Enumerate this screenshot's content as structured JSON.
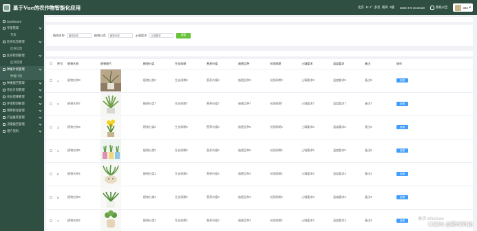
{
  "header": {
    "title": "基于Vue的农作物智能化应用",
    "location": "北京",
    "temperature": "11.1°",
    "weather": "多云",
    "wind": "南风",
    "wind_level": "2级",
    "datetime": "2024-4-9 10:20:23",
    "notice_label": "系统公告",
    "user_label": "333"
  },
  "sidebar": {
    "items": [
      {
        "label": "Dashboard",
        "type": "item"
      },
      {
        "label": "专家管理",
        "type": "group"
      },
      {
        "label": "专家",
        "type": "sub"
      },
      {
        "label": "区块信息管理",
        "type": "group"
      },
      {
        "label": "区块信息",
        "type": "sub"
      },
      {
        "label": "区块检测管理",
        "type": "group"
      },
      {
        "label": "区块检测",
        "type": "sub"
      },
      {
        "label": "种植计划管理",
        "type": "group-active"
      },
      {
        "label": "种植计划",
        "type": "sub-active"
      },
      {
        "label": "种植报告管理",
        "type": "group"
      },
      {
        "label": "作业计划管理",
        "type": "group"
      },
      {
        "label": "农业措施管理",
        "type": "group"
      },
      {
        "label": "环境检测管理",
        "type": "group"
      },
      {
        "label": "预警转化管理",
        "type": "group"
      },
      {
        "label": "产品推荐管理",
        "type": "group"
      },
      {
        "label": "决策报告管理",
        "type": "group"
      },
      {
        "label": "用户资料",
        "type": "group"
      }
    ]
  },
  "search": {
    "name_label": "植物名称",
    "name_placeholder": "植物名称",
    "category_label": "植物分类",
    "category_placeholder": "植物分类",
    "soil_label": "土壤要求",
    "soil_placeholder": "土壤要求",
    "button_label": "搜索"
  },
  "table": {
    "columns": [
      "",
      "序号",
      "植物名称",
      "植物图片",
      "植物分类",
      "生长周期",
      "营养价值",
      "施肥品种",
      "光照周期",
      "土壤要求",
      "温度要求",
      "备注",
      "操作"
    ],
    "rows": [
      {
        "index": "1",
        "name": "植物名称8",
        "category": "植物分类8",
        "cycle": "生长周期8",
        "nutrition": "营养价值8",
        "fertilizer": "施肥品种8",
        "light": "光照周期8",
        "soil": "土壤要求8",
        "temp": "温度要求8",
        "note": "备注8",
        "action": "查看"
      },
      {
        "index": "2",
        "name": "植物名称7",
        "category": "植物分类7",
        "cycle": "生长周期7",
        "nutrition": "营养价值7",
        "fertilizer": "施肥品种7",
        "light": "光照周期7",
        "soil": "土壤要求7",
        "temp": "温度要求7",
        "note": "备注7",
        "action": "查看"
      },
      {
        "index": "3",
        "name": "植物名称6",
        "category": "植物分类6",
        "cycle": "生长周期6",
        "nutrition": "营养价值6",
        "fertilizer": "施肥品种6",
        "light": "光照周期6",
        "soil": "土壤要求6",
        "temp": "温度要求6",
        "note": "备注6",
        "action": "查看"
      },
      {
        "index": "4",
        "name": "植物名称5",
        "category": "植物分类5",
        "cycle": "生长周期5",
        "nutrition": "营养价值5",
        "fertilizer": "施肥品种5",
        "light": "光照周期5",
        "soil": "土壤要求5",
        "temp": "温度要求5",
        "note": "备注5",
        "action": "查看"
      },
      {
        "index": "5",
        "name": "植物名称4",
        "category": "植物分类4",
        "cycle": "生长周期4",
        "nutrition": "营养价值4",
        "fertilizer": "施肥品种4",
        "light": "光照周期4",
        "soil": "土壤要求4",
        "temp": "温度要求4",
        "note": "备注4",
        "action": "查看"
      },
      {
        "index": "6",
        "name": "植物名称3",
        "category": "植物分类3",
        "cycle": "生长周期3",
        "nutrition": "营养价值3",
        "fertilizer": "施肥品种3",
        "light": "光照周期3",
        "soil": "土壤要求3",
        "temp": "温度要求3",
        "note": "备注3",
        "action": "查看"
      },
      {
        "index": "7",
        "name": "植物名称2",
        "category": "植物分类2",
        "cycle": "生长周期2",
        "nutrition": "营养价值2",
        "fertilizer": "施肥品种2",
        "light": "光照周期2",
        "soil": "土壤要求2",
        "temp": "温度要求2",
        "note": "备注2",
        "action": "查看"
      }
    ]
  },
  "overlay": {
    "windows_text": "激活 Windows",
    "watermark": "CSDN @辞时科技"
  },
  "colors": {
    "sidebar_bg": "#2f4f43",
    "search_button": "#67c23a",
    "view_button": "#409eff"
  }
}
